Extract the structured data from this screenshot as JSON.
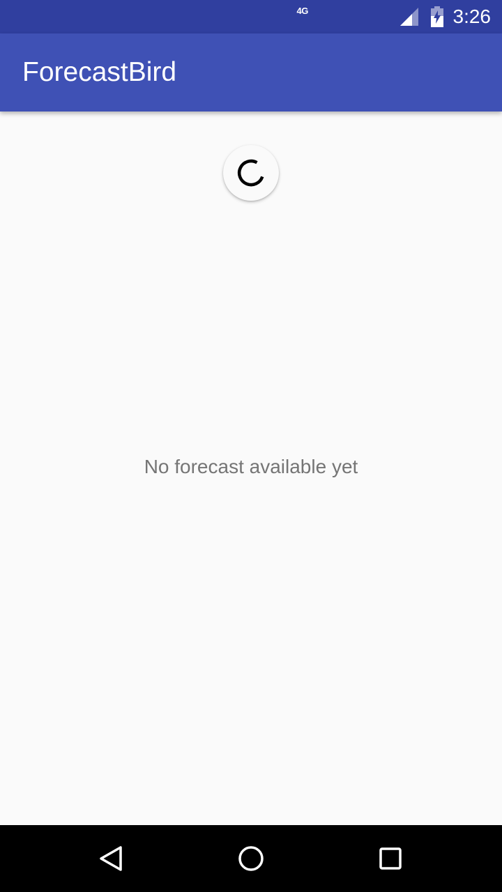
{
  "status_bar": {
    "network_type": "4G",
    "time": "3:26",
    "icons": [
      "signal-icon",
      "battery-icon"
    ]
  },
  "app_bar": {
    "title": "ForecastBird"
  },
  "main": {
    "refresh_indicator": "progress-spinner-icon",
    "empty_message": "No forecast available yet"
  },
  "nav_bar": {
    "buttons": [
      "back-icon",
      "home-icon",
      "recents-icon"
    ]
  },
  "colors": {
    "status_bar": "#303f9f",
    "app_bar": "#3f51b5",
    "background": "#fafafa",
    "empty_text": "#757575",
    "nav_bar": "#000000"
  }
}
